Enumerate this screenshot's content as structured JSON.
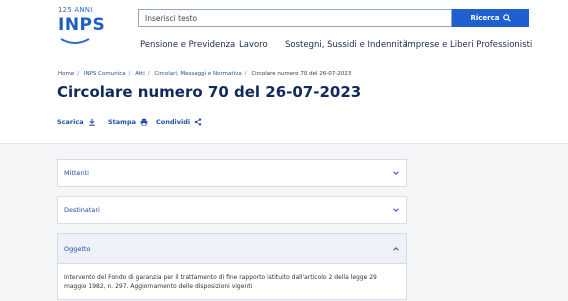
{
  "header": {
    "logo_anniversary": "125 ANNI",
    "logo_name": "INPS",
    "search_placeholder": "Inserisci testo",
    "search_button": "Ricerca",
    "nav": [
      "Pensione e Previdenza",
      "Lavoro",
      "Sostegni, Sussidi e Indennità",
      "Imprese e Liberi Professionisti"
    ]
  },
  "breadcrumb": [
    "Home",
    "INPS Comunica",
    "Atti",
    "Circolari, Messaggi e Normativa",
    "Circolare numero 70 del 26-07-2023"
  ],
  "page_title": "Circolare numero 70 del 26-07-2023",
  "actions": {
    "download": "Scarica",
    "print": "Stampa",
    "share": "Condividi"
  },
  "accordion": [
    {
      "label": "Mittenti",
      "expanded": false
    },
    {
      "label": "Destinatari",
      "expanded": false
    },
    {
      "label": "Oggetto",
      "expanded": true
    }
  ],
  "oggetto_text": "Intervento del Fondo di garanzia per il trattamento di fine rapporto istituito dall'articolo 2 della legge 29 maggio 1982, n. 297. Aggiornamento delle disposizioni vigenti",
  "colors": {
    "primary": "#1f5fcf",
    "title": "#0f2a5c",
    "link": "#1f4fa8"
  }
}
